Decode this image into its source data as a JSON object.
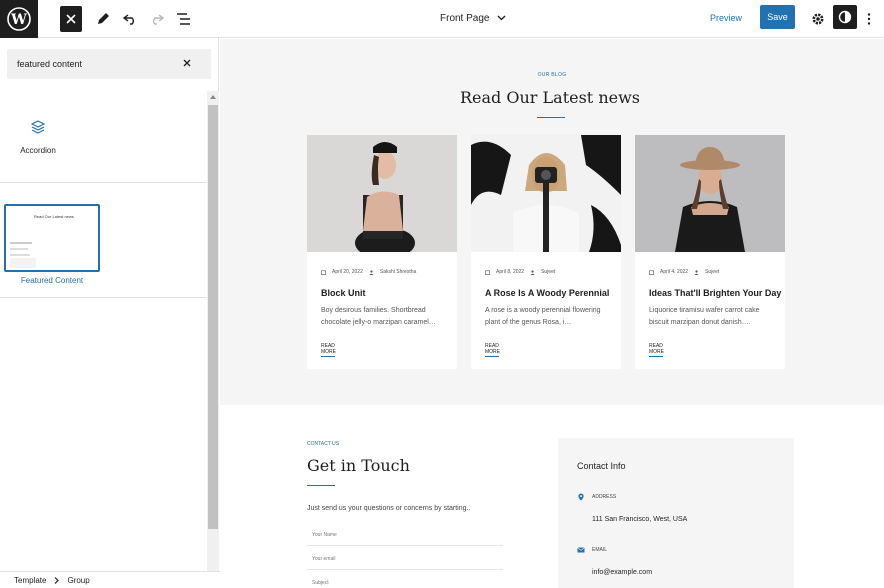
{
  "topbar": {
    "document_title": "Front Page",
    "preview_label": "Preview",
    "save_label": "Save"
  },
  "sidebar": {
    "search_value": "featured content",
    "block_result": {
      "label": "Accordion",
      "icon": "stack-icon"
    },
    "pattern_result": {
      "label": "Featured Content",
      "thumbnail_title": "Read Our Latest news"
    }
  },
  "breadcrumb": {
    "items": [
      "Template",
      "Group"
    ]
  },
  "canvas": {
    "blog": {
      "eyebrow": "OUR BLOG",
      "title": "Read Our Latest news",
      "read_more": "READ MORE",
      "posts": [
        {
          "date": "April 20, 2022",
          "author": "Sakshi Shrestha",
          "title": "Block Unit",
          "excerpt": "Boy desirous families. Shortbread chocolate jelly-o marzipan caramel…"
        },
        {
          "date": "April 8, 2022",
          "author": "Sujeet",
          "title": "A Rose Is A Woody Perennial",
          "excerpt": "A rose is a woody perennial flowering plant of the genus Rosa, i…"
        },
        {
          "date": "April 4, 2022",
          "author": "Sujeet",
          "title": "Ideas That'll Brighten Your Day",
          "excerpt": "Liquorice tiramisu wafer carrot cake biscuit marzipan donut danish…."
        }
      ]
    },
    "contact": {
      "eyebrow": "CONTACT US",
      "title": "Get in Touch",
      "intro": "Just send us your questions or concerns by starting..",
      "fields": [
        "Your Name",
        "Your email",
        "Subject"
      ],
      "info_title": "Contact Info",
      "address_label": "ADDRESS",
      "address_value": "111 San Francisco, West, USA",
      "email_label": "EMAIL",
      "email_value": "info@example.com"
    }
  },
  "colors": {
    "accent": "#2271b1",
    "dark": "#1e1e1e",
    "section_bg": "#f5f5f5"
  }
}
